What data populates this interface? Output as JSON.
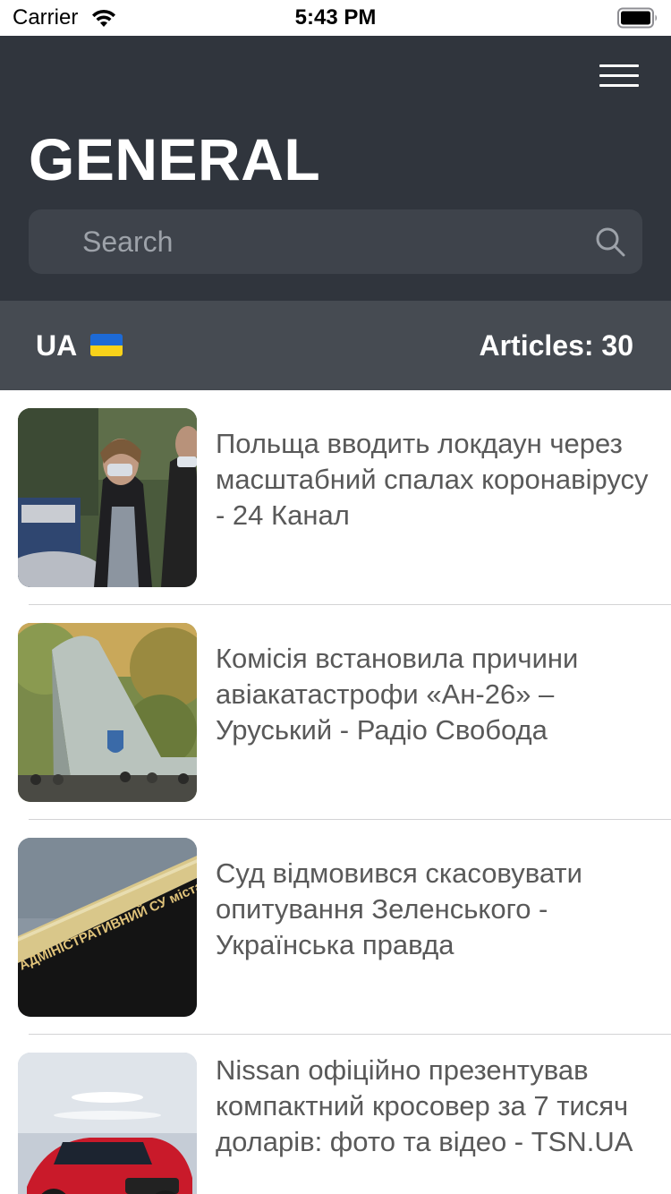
{
  "status_bar": {
    "carrier": "Carrier",
    "time": "5:43 PM",
    "wifi_icon": "wifi-icon",
    "battery_icon": "battery-icon"
  },
  "header": {
    "title": "GENERAL",
    "menu_icon": "hamburger-menu-icon",
    "background_color": "#30353d"
  },
  "search": {
    "placeholder": "Search",
    "value": "",
    "icon": "search-icon",
    "background_color": "#3e434b"
  },
  "info_bar": {
    "country": "UA",
    "flag_icon": "ukraine-flag-icon",
    "articles_count": "Articles: 30",
    "background_color": "#464b52"
  },
  "articles": [
    {
      "title": "Польща вводить локдаун через масштабний спалах коронавірусу - 24 Канал",
      "image": "people-in-masks-photo"
    },
    {
      "title": "Комісія встановила причини авіакатастрофи «Ан-26» – Уруський - Радіо Свобода",
      "image": "an-26-plane-tail-photo"
    },
    {
      "title": "Суд відмовився скасовувати опитування Зеленського - Українська правда",
      "image": "administrative-court-building-photo",
      "image_text": "АДМІНІСТРАТИВНИЙ СУ міста Києва"
    },
    {
      "title": "Nissan офіційно презентував компактний кросовер за 7 тисяч доларів: фото та відео - TSN.UA",
      "image": "nissan-red-crossover-photo"
    }
  ]
}
